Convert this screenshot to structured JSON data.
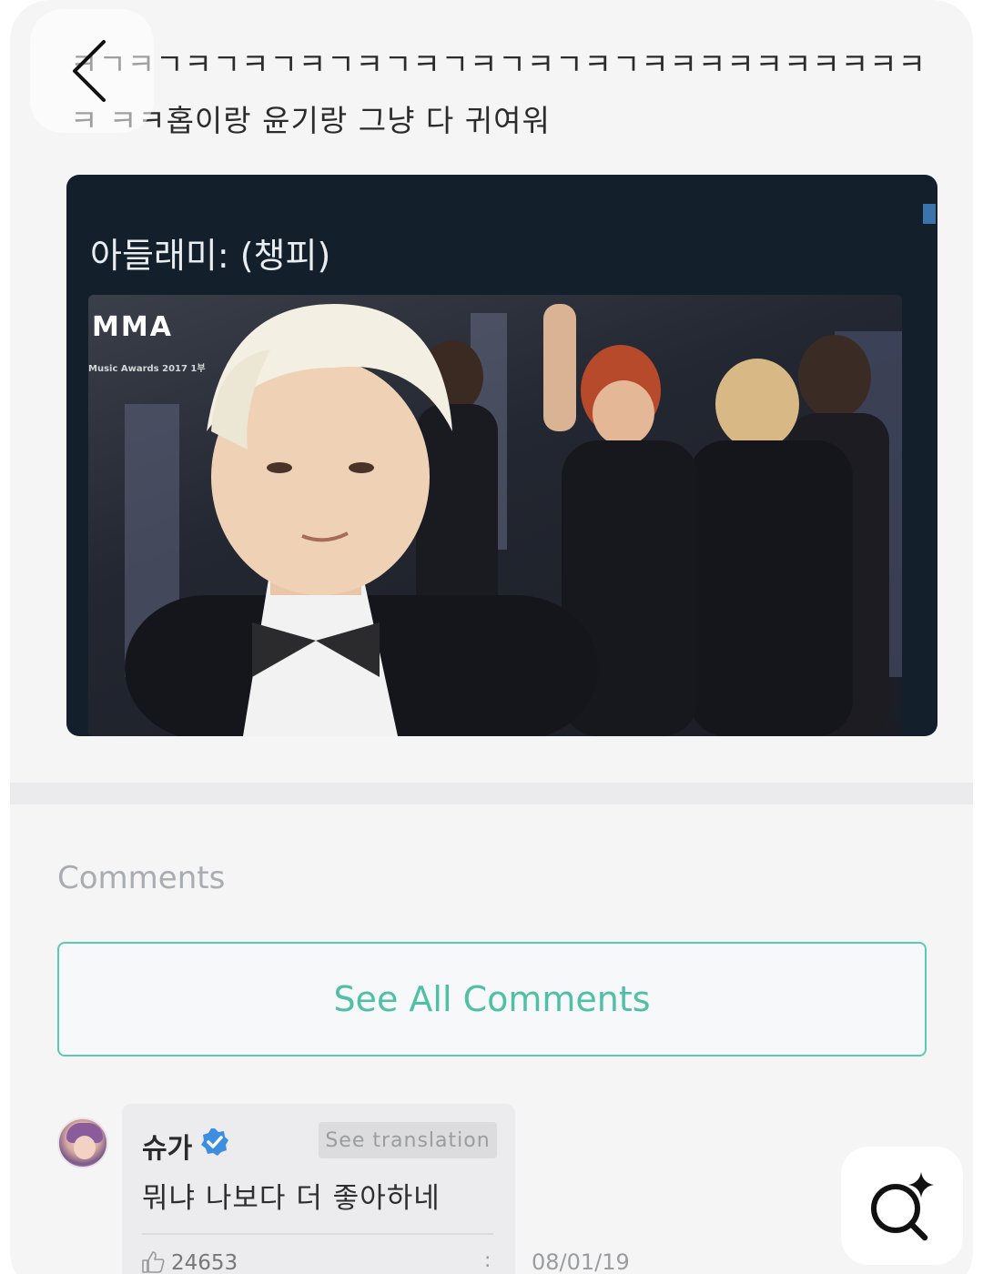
{
  "nav": {
    "back_icon": "chevron-left-icon"
  },
  "post": {
    "text": "ㅋㄱㅋㄱㅋㄱㅋㄱㅋㄱㅋㄱㅋㄱㅋㄱㅋㄱㅋㄱㅋㅋㅋㅋㅋㅋㅋㅋㅋㅋㅋ ㅋㅋ홉이랑 윤기랑 그냥 다 귀여워",
    "image": {
      "cut_text": "",
      "caption": "아들래미: (챙피)",
      "logo_text": "MMA",
      "logo_sub": "Music Awards 2017 1부"
    }
  },
  "comments": {
    "heading": "Comments",
    "see_all_label": "See All Comments",
    "items": [
      {
        "author": "슈가",
        "verified": true,
        "translate_label": "See translation",
        "text": "뭐냐 나보다 더 좋아하네",
        "likes": "24653",
        "date": "08/01/19"
      }
    ]
  },
  "colors": {
    "accent": "#4fc0a6",
    "verified": "#3d8de0",
    "background": "#f5f5f6",
    "image_card": "#13202c"
  },
  "floating": {
    "icon": "lens-search-sparkle-icon"
  }
}
